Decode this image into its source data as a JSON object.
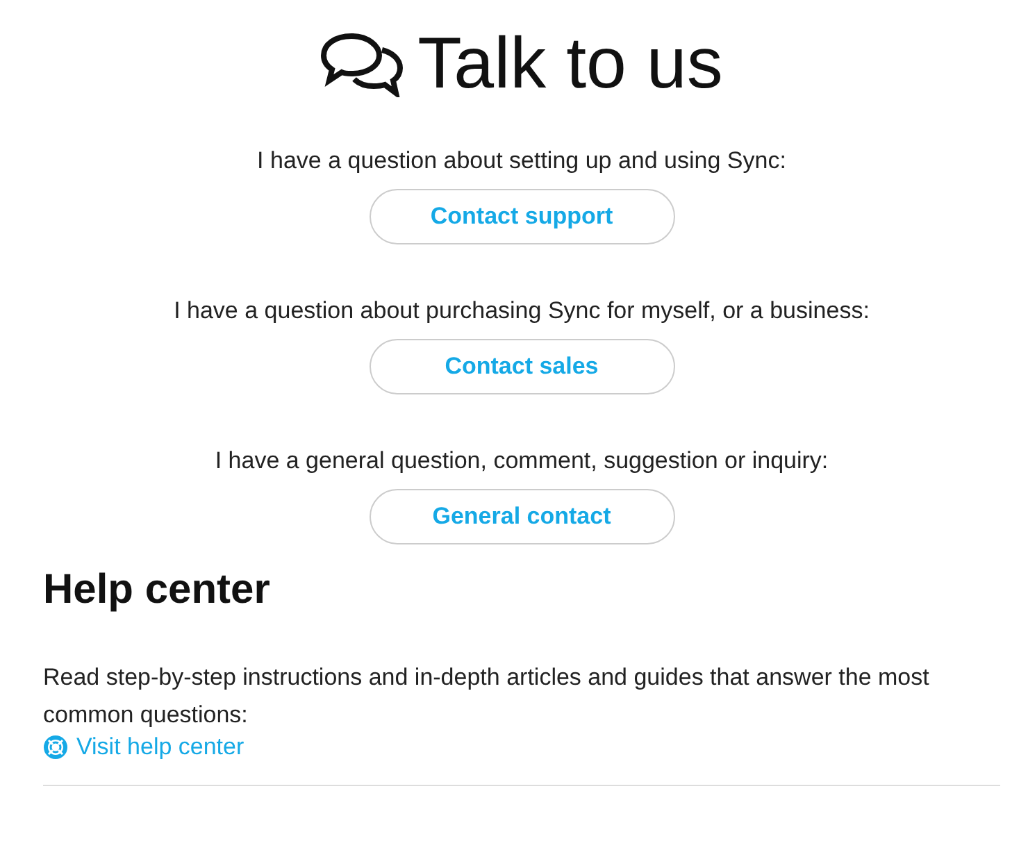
{
  "title": "Talk to us",
  "contacts": [
    {
      "question": "I have a question about setting up and using Sync:",
      "button": "Contact support"
    },
    {
      "question": "I have a question about purchasing Sync for myself, or a business:",
      "button": "Contact sales"
    },
    {
      "question": "I have a general question, comment, suggestion or inquiry:",
      "button": "General contact"
    }
  ],
  "help_center": {
    "heading": "Help center",
    "text": "Read step-by-step instructions and in-depth articles and guides that answer the most common questions:",
    "link": "Visit help center"
  }
}
